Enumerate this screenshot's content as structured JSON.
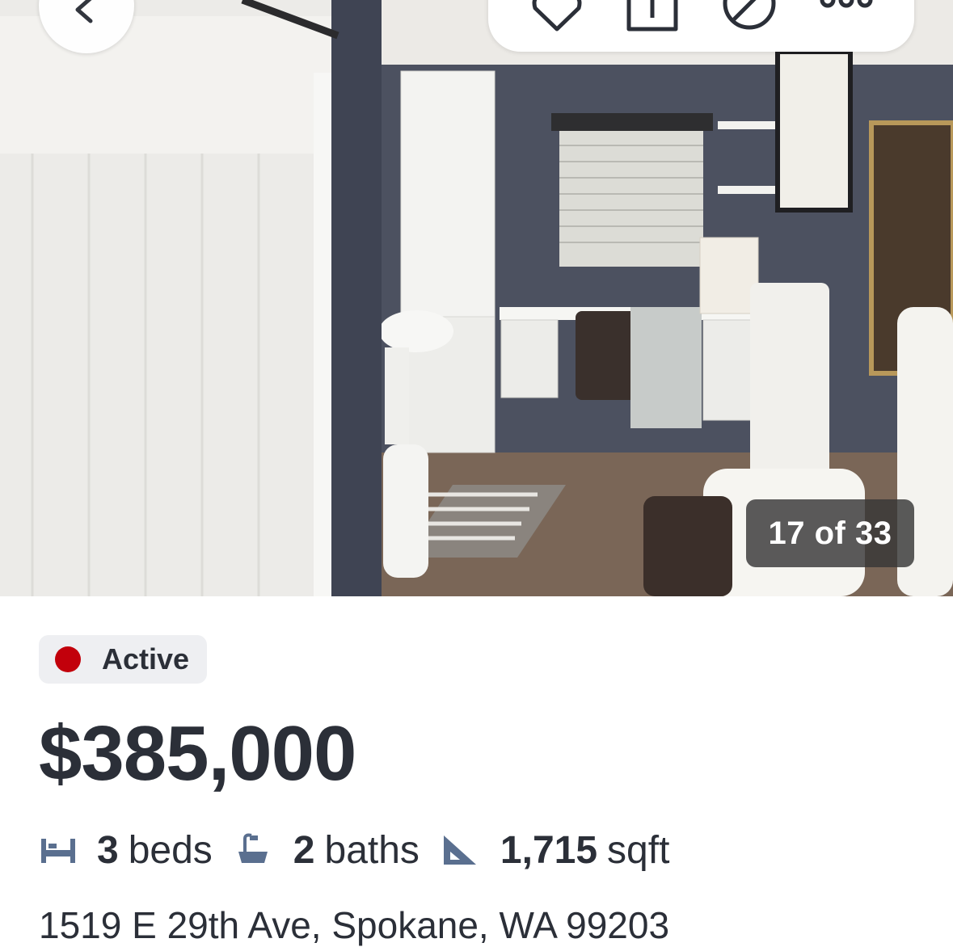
{
  "listing_photo": {
    "counter_label": "17 of 33",
    "icons": {
      "back": "chevron-left-icon",
      "favorite": "heart-icon",
      "share": "share-icon",
      "hide": "hide-icon",
      "more": "more-icon"
    }
  },
  "status": {
    "label": "Active",
    "color": "#c2000b"
  },
  "price": "$385,000",
  "facts": {
    "beds_count": "3",
    "beds_label": "beds",
    "baths_count": "2",
    "baths_label": "baths",
    "sqft_count": "1,715",
    "sqft_label": "sqft",
    "icon_color": "#5a6f8f"
  },
  "address": "1519 E 29th Ave, Spokane, WA 99203"
}
